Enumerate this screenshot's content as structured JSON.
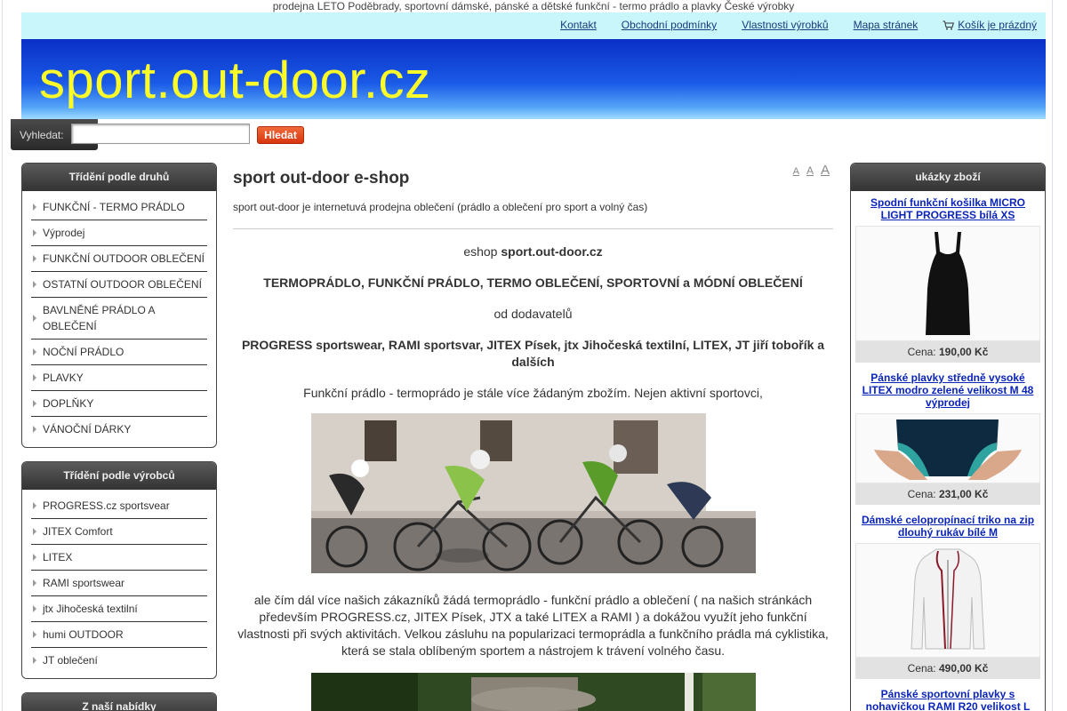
{
  "header": {
    "tagline": "prodejna LETO Poděbrady, sportovní dámské, pánské a dětské funkční - termo prádlo a plavky České výrobky",
    "nav": [
      {
        "label": "Kontakt"
      },
      {
        "label": "Obchodní podmínky"
      },
      {
        "label": "Vlastnosti výrobků"
      },
      {
        "label": "Mapa stránek"
      }
    ],
    "cart_label": "Košík je prázdný",
    "site_title": "sport.out-door.cz"
  },
  "search": {
    "label": "Vyhledat:",
    "value": "",
    "placeholder": "",
    "button": "Hledat"
  },
  "sidebar": {
    "categories": {
      "title": "Třídění podle druhů",
      "items": [
        {
          "label": "FUNKČNÍ - TERMO PRÁDLO"
        },
        {
          "label": "Výprodej"
        },
        {
          "label": "FUNKČNÍ OUTDOOR OBLEČENÍ"
        },
        {
          "label": "OSTATNÍ OUTDOOR OBLEČENÍ"
        },
        {
          "label": "BAVLNĚNÉ PRÁDLO A OBLEČENÍ"
        },
        {
          "label": "NOČNÍ PRÁDLO"
        },
        {
          "label": "PLAVKY"
        },
        {
          "label": "DOPLŇKY"
        },
        {
          "label": "VÁNOČNÍ DÁRKY"
        }
      ]
    },
    "manufacturers": {
      "title": "Třídění podle výrobců",
      "items": [
        {
          "label": "PROGRESS.cz sportsvear"
        },
        {
          "label": "JITEX Comfort"
        },
        {
          "label": "LITEX"
        },
        {
          "label": "RAMI sportswear"
        },
        {
          "label": "jtx Jihočeská textilní"
        },
        {
          "label": "humi OUTDOOR"
        },
        {
          "label": "JT oblečení"
        }
      ]
    },
    "offer": {
      "title": "Z naší nabídky"
    }
  },
  "main": {
    "title": "sport out-door e-shop",
    "subtitle": "sport out-door je internetuvá prodejna oblečení (prádlo a oblečení pro sport a volný čas)",
    "font_sizes": [
      "A",
      "A",
      "A"
    ],
    "eshop_prefix": "eshop ",
    "eshop_name": "sport.out-door.cz",
    "headline": "TERMOPRÁDLO, FUNKČNÍ PRÁDLO, TERMO OBLEČENÍ, SPORTOVNÍ a MÓDNÍ OBLEČENÍ",
    "suppliers_intro": "od dodavatelů",
    "suppliers": "PROGRESS sportswear, RAMI sportsvar, JITEX Písek, jtx Jihočeská textilní, LITEX, JT jiří tobořík a dalších",
    "paragraph1": "Funkční prádlo - termoprádo je stále více žádaným zbožím. Nejen aktivní sportovci,",
    "paragraph2": "ale čím dál více našich zákazníků žádá termoprádlo - funkční prádlo a oblečení ( na našich stránkách především PROGRESS.cz, JITEX Písek, JTX a také LITEX a RAMI ) a dokážou využít jeho funkční vlastnosti při svých aktivitách. Velkou zásluhu na popularizaci termoprádla a funkčního prádla má cyklistika, která se stala oblíbeným sportem a nástrojem k trávení volného času."
  },
  "products": {
    "title": "ukázky zboží",
    "price_label": "Cena:",
    "items": [
      {
        "name": "Spodní funkční košilka MICRO LIGHT PROGRESS bílá XS",
        "price": "190,00 Kč",
        "icon": "black-camisole-image"
      },
      {
        "name": "Pánské plavky středně vysoké LITEX modro zelené velikost M 48 výprodej",
        "price": "231,00 Kč",
        "icon": "swim-briefs-image"
      },
      {
        "name": "Dámské celopropínací triko na zip dlouhý rukáv bílé M",
        "price": "490,00 Kč",
        "icon": "white-zip-jacket-image"
      },
      {
        "name": "Pánské sportovní plavky s nohavičkou RAMI R20 velikost L",
        "price": "",
        "icon": "swim-shorts-image"
      }
    ]
  },
  "colors": {
    "banner_title": "#fbfb2a",
    "banner_top": "#0a2fc7",
    "link": "#0b24b8",
    "search_button": "#e04a20"
  }
}
